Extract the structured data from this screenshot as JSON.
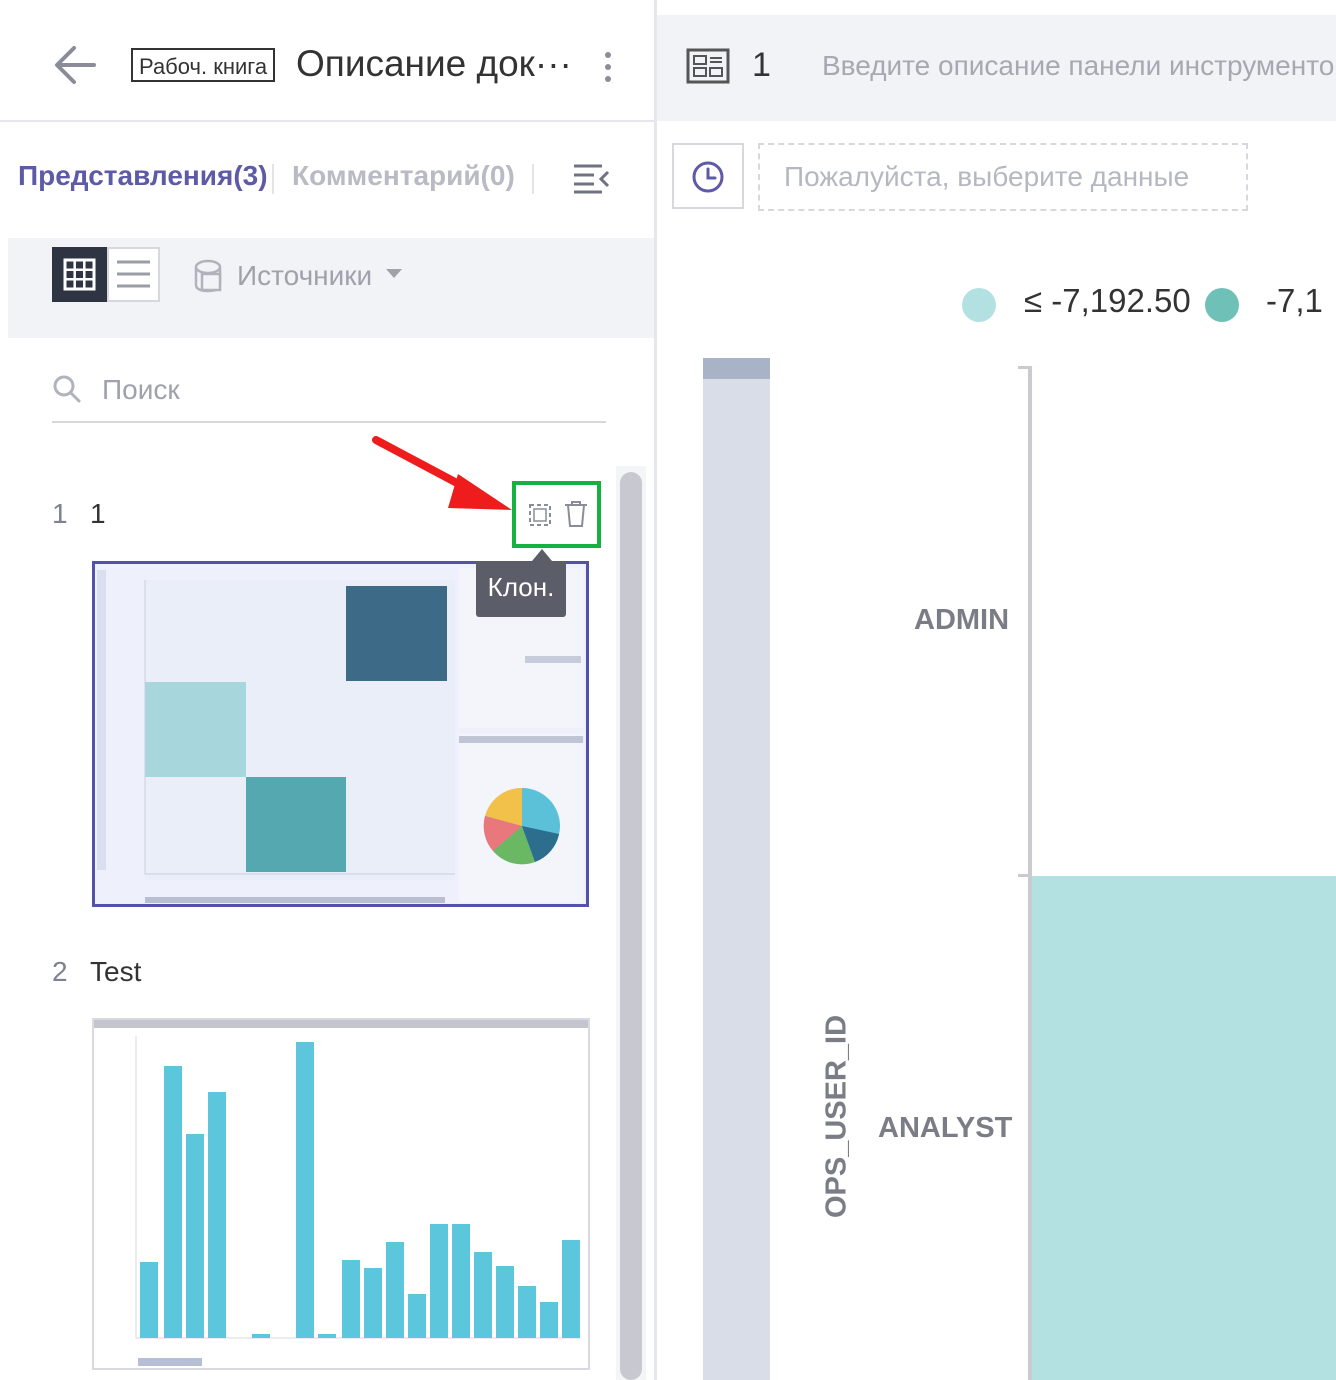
{
  "header": {
    "workbook_badge": "Рабоч. книга",
    "title": "Описание док···"
  },
  "tabs": [
    {
      "label": "Представления(3)",
      "active": true
    },
    {
      "label": "Комментарий(0)",
      "active": false
    }
  ],
  "toolbar": {
    "sources_label": "Источники"
  },
  "search": {
    "placeholder": "Поиск",
    "value": ""
  },
  "views": [
    {
      "num": "1",
      "name": "1",
      "tooltip": "Клон.",
      "action_icons": [
        "clone-icon",
        "trash-icon"
      ]
    },
    {
      "num": "2",
      "name": "Test"
    }
  ],
  "dashboard": {
    "number": "1",
    "description_placeholder": "Введите описание панели инструментов",
    "data_placeholder": "Пожалуйста, выберите данные",
    "legend": [
      {
        "label": "≤ -7,192.50",
        "color": "#b3e1e2"
      },
      {
        "label": "-7,1",
        "color": "#6fc0b6"
      }
    ],
    "y_axis_title": "OPS_USER_ID",
    "y_categories": [
      "ADMIN",
      "ANALYST"
    ]
  },
  "colors": {
    "accent": "#5d5aa6",
    "highlight": "#16b140",
    "annotation_arrow": "#ee1c1c"
  }
}
